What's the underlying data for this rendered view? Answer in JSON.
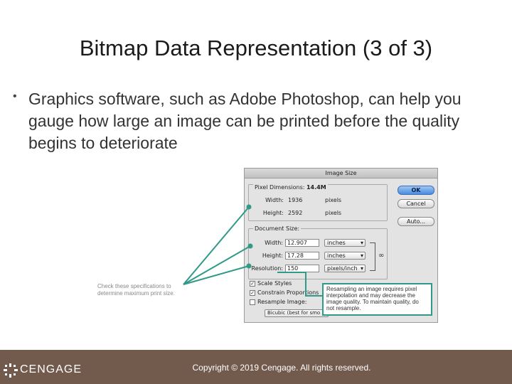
{
  "slide": {
    "title": "Bitmap Data Representation (3 of 3)",
    "bullet": "Graphics software, such as Adobe Photoshop, can help you gauge how large an image can be printed before the quality begins  to deteriorate"
  },
  "dialog": {
    "title": "Image Size",
    "pixel_dimensions": {
      "label": "Pixel Dimensions:",
      "value": "14.4M",
      "width_label": "Width:",
      "width_value": "1936",
      "width_unit": "pixels",
      "height_label": "Height:",
      "height_value": "2592",
      "height_unit": "pixels"
    },
    "document_size": {
      "label": "Document Size:",
      "width_label": "Width:",
      "width_value": "12.907",
      "width_unit": "inches",
      "height_label": "Height:",
      "height_value": "17.28",
      "height_unit": "inches",
      "resolution_label": "Resolution:",
      "resolution_value": "150",
      "resolution_unit": "pixels/inch"
    },
    "buttons": {
      "ok": "OK",
      "cancel": "Cancel",
      "auto": "Auto..."
    },
    "options": {
      "scale_styles": "Scale Styles",
      "constrain_proportions": "Constrain Proportions",
      "resample_image": "Resample Image:",
      "interpolation": "Bicubic (best for smo"
    }
  },
  "callout": "Resampling an image requires pixel interpolation and may decrease the image quality. To maintain quality, do not resample.",
  "side_note": "Check these specifications to determine maximum print size.",
  "footer": {
    "logo": "CENGAGE",
    "copyright": "Copyright © 2019 Cengage. All rights reserved."
  },
  "colors": {
    "footer": "#725a4d",
    "callout": "#2f9a87",
    "ok_button": "#4a8ce0"
  }
}
